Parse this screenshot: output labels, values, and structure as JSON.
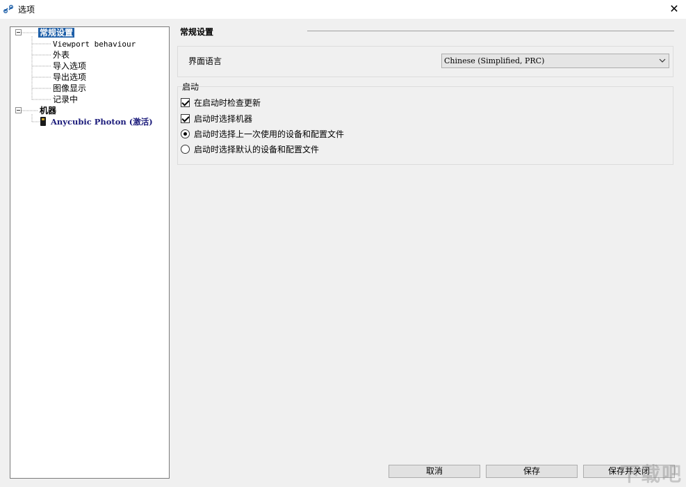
{
  "window": {
    "title": "选项",
    "close_glyph": "✕"
  },
  "tree": {
    "items": [
      {
        "label": "常规设置"
      },
      {
        "label": "Viewport behaviour"
      },
      {
        "label": "外表"
      },
      {
        "label": "导入选项"
      },
      {
        "label": "导出选项"
      },
      {
        "label": "图像显示"
      },
      {
        "label": "记录中"
      },
      {
        "label": "机器"
      },
      {
        "label": "Anycubic Photon (激活)"
      }
    ]
  },
  "panel": {
    "title": "常规设置",
    "language": {
      "label": "界面语言",
      "value": "Chinese (Simplified, PRC)"
    },
    "startup": {
      "label": "启动",
      "options": [
        {
          "label": "在启动时检查更新",
          "kind": "checkbox",
          "checked": true
        },
        {
          "label": "启动时选择机器",
          "kind": "checkbox",
          "checked": true
        },
        {
          "label": "启动时选择上一次使用的设备和配置文件",
          "kind": "radio",
          "checked": true
        },
        {
          "label": "启动时选择默认的设备和配置文件",
          "kind": "radio",
          "checked": false
        }
      ]
    }
  },
  "buttons": {
    "cancel": "取消",
    "save": "保存",
    "save_close": "保存并关闭"
  },
  "watermark": "下载吧",
  "icons": {
    "app": "chain-link-icon",
    "device": "printer-device-icon",
    "close": "close-icon"
  },
  "colors": {
    "selection": "#1e5fa8",
    "device_text": "#1a1a7a",
    "client_bg": "#f0f0f0"
  }
}
